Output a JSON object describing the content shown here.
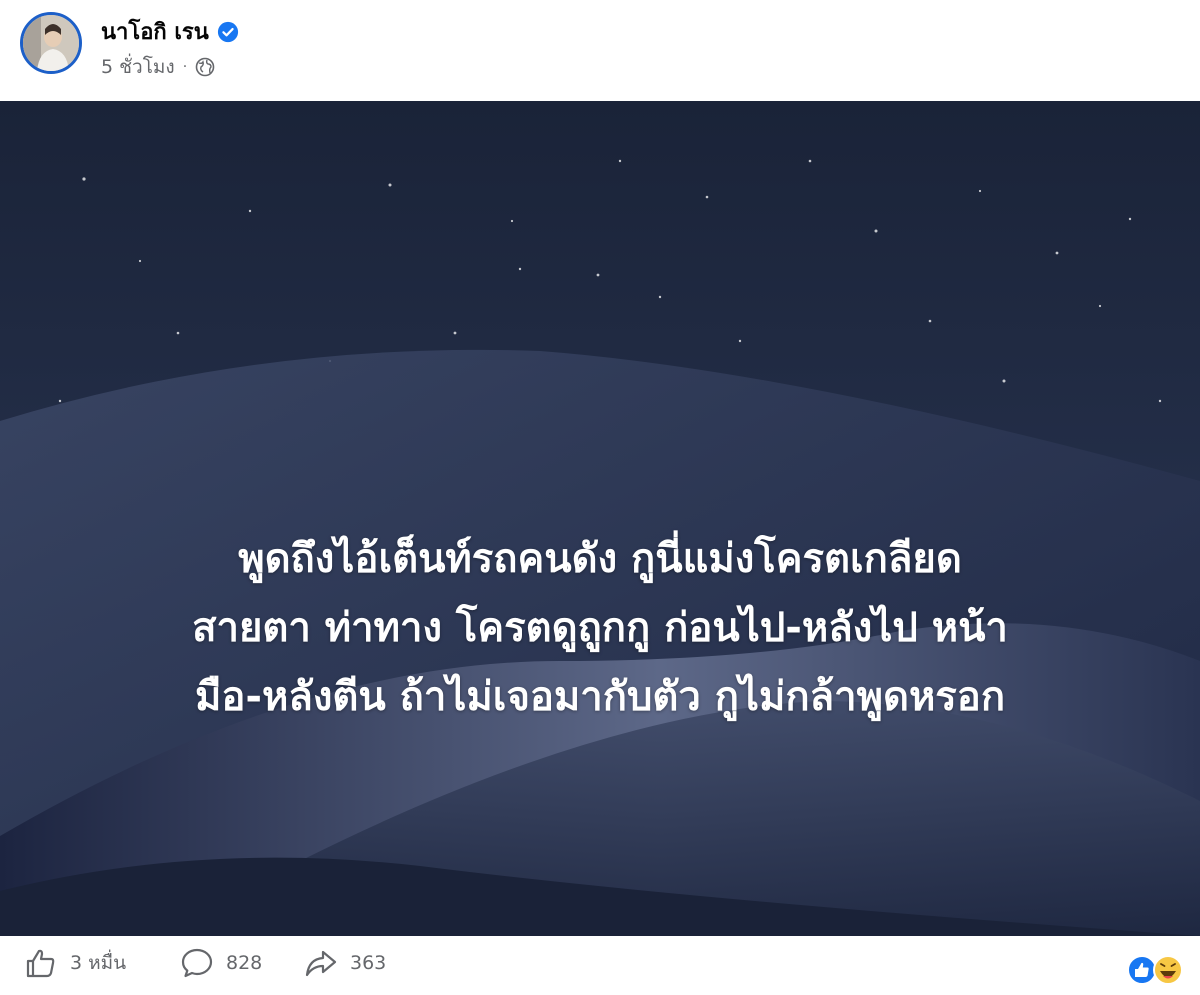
{
  "post": {
    "author_name": "นาโอกิ เรน",
    "timestamp": "5 ชั่วโมง",
    "separator": "·",
    "privacy_icon": "globe-icon",
    "verified_icon": "verified-badge-icon",
    "text_lines": [
      "พูดถึงไอ้เต็นท์รถคนดัง กูนี่แม่งโครตเกลียด",
      "สายตา ท่าทาง โครตดูถูกกู ก่อนไป-หลังไป หน้า",
      "มือ-หลังตีน ถ้าไม่เจอมากับตัว กูไม่กล้าพูดหรอก"
    ]
  },
  "stats": {
    "like_count": "3 หมื่น",
    "comment_count": "828",
    "share_count": "363",
    "like_icon": "thumbs-up-icon",
    "comment_icon": "comment-icon",
    "share_icon": "share-icon",
    "reaction_icons": [
      "like-reaction-icon",
      "haha-reaction-icon"
    ]
  },
  "colors": {
    "accent": "#1877f2",
    "secondary_text": "#65676b",
    "background_sky": "#1d2740",
    "post_text": "#ffffff"
  }
}
